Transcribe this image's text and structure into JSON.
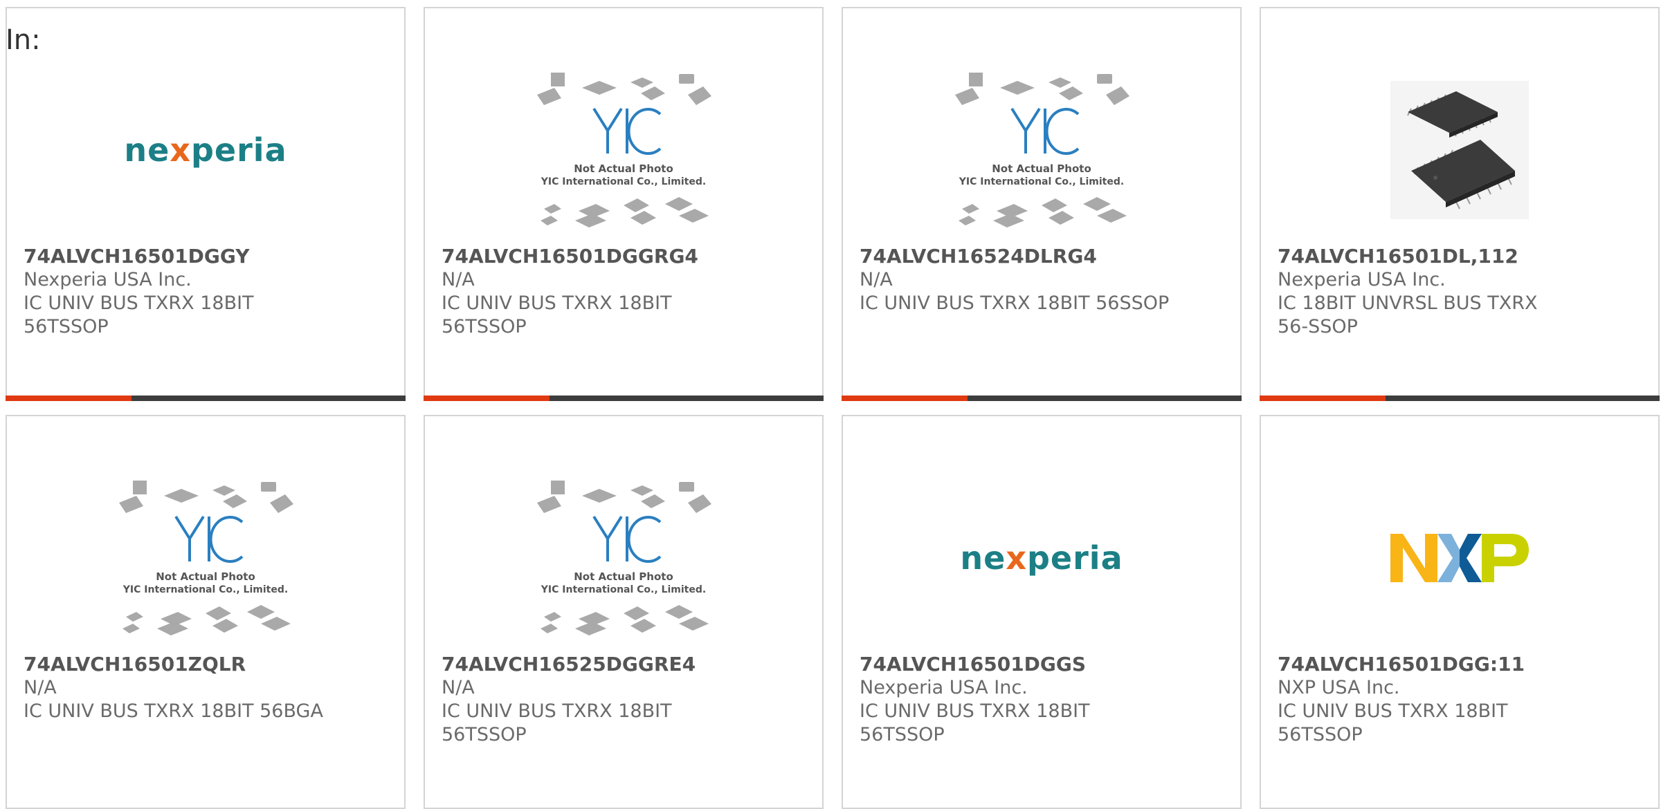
{
  "page": {
    "in_label": "In:"
  },
  "colors": {
    "accent_red": "#e03a12",
    "bar_dark": "#3d3d3d",
    "nexperia_teal": "#1c7f86"
  },
  "placeholder_image": {
    "line1": "Not Actual Photo",
    "line2": "YIC International Co., Limited.",
    "logo_text": "YIC"
  },
  "logos": {
    "nexperia": "nexperia",
    "nxp": "NXP"
  },
  "cards": [
    {
      "part": "74ALVCH16501DGGY",
      "maker": "Nexperia USA Inc.",
      "desc": "IC UNIV BUS TXRX 18BIT 56TSSOP",
      "image": "nexperia-logo"
    },
    {
      "part": "74ALVCH16501DGGRG4",
      "maker": "N/A",
      "desc": "IC UNIV BUS TXRX 18BIT 56TSSOP",
      "image": "yic-placeholder"
    },
    {
      "part": "74ALVCH16524DLRG4",
      "maker": "N/A",
      "desc": "IC UNIV BUS TXRX 18BIT 56SSOP",
      "image": "yic-placeholder"
    },
    {
      "part": "74ALVCH16501DL,112",
      "maker": "Nexperia USA Inc.",
      "desc": "IC 18BIT UNVRSL BUS TXRX 56-SSOP",
      "image": "chip-photo"
    },
    {
      "part": "74ALVCH16501ZQLR",
      "maker": "N/A",
      "desc": "IC UNIV BUS TXRX 18BIT 56BGA",
      "image": "yic-placeholder"
    },
    {
      "part": "74ALVCH16525DGGRE4",
      "maker": "N/A",
      "desc": "IC UNIV BUS TXRX 18BIT 56TSSOP",
      "image": "yic-placeholder"
    },
    {
      "part": "74ALVCH16501DGGS",
      "maker": "Nexperia USA Inc.",
      "desc": "IC UNIV BUS TXRX 18BIT 56TSSOP",
      "image": "nexperia-logo"
    },
    {
      "part": "74ALVCH16501DGG:11",
      "maker": "NXP USA Inc.",
      "desc": "IC UNIV BUS TXRX 18BIT 56TSSOP",
      "image": "nxp-logo"
    }
  ]
}
